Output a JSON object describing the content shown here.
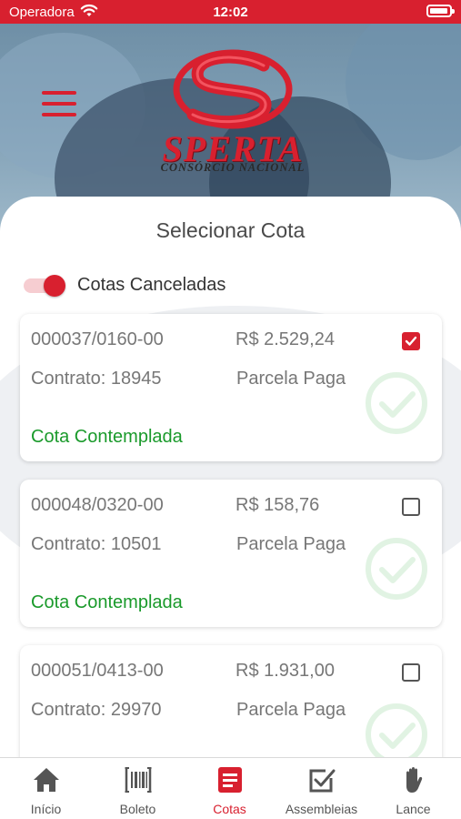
{
  "status_bar": {
    "carrier": "Operadora",
    "time": "12:02"
  },
  "brand": {
    "name": "SPERTA",
    "tagline": "CONSÓRCIO NACIONAL",
    "color": "#d8202f"
  },
  "page": {
    "title": "Selecionar Cota"
  },
  "filter": {
    "label": "Cotas Canceladas",
    "enabled": true
  },
  "cotas": [
    {
      "cota": "000037/0160-00",
      "valor": "R$ 2.529,24",
      "contrato": "Contrato: 18945",
      "parcela": "Parcela Paga",
      "status": "Cota Contemplada",
      "selected": true
    },
    {
      "cota": "000048/0320-00",
      "valor": "R$ 158,76",
      "contrato": "Contrato: 10501",
      "parcela": "Parcela Paga",
      "status": "Cota Contemplada",
      "selected": false
    },
    {
      "cota": "000051/0413-00",
      "valor": "R$ 1.931,00",
      "contrato": "Contrato: 29970",
      "parcela": "Parcela Paga",
      "status": "",
      "selected": false
    }
  ],
  "tabbar": {
    "active": "Cotas",
    "items": [
      {
        "label": "Início",
        "icon": "home-icon"
      },
      {
        "label": "Boleto",
        "icon": "barcode-icon"
      },
      {
        "label": "Cotas",
        "icon": "document-icon"
      },
      {
        "label": "Assembleias",
        "icon": "checkbox-icon"
      },
      {
        "label": "Lance",
        "icon": "hand-icon"
      }
    ]
  }
}
